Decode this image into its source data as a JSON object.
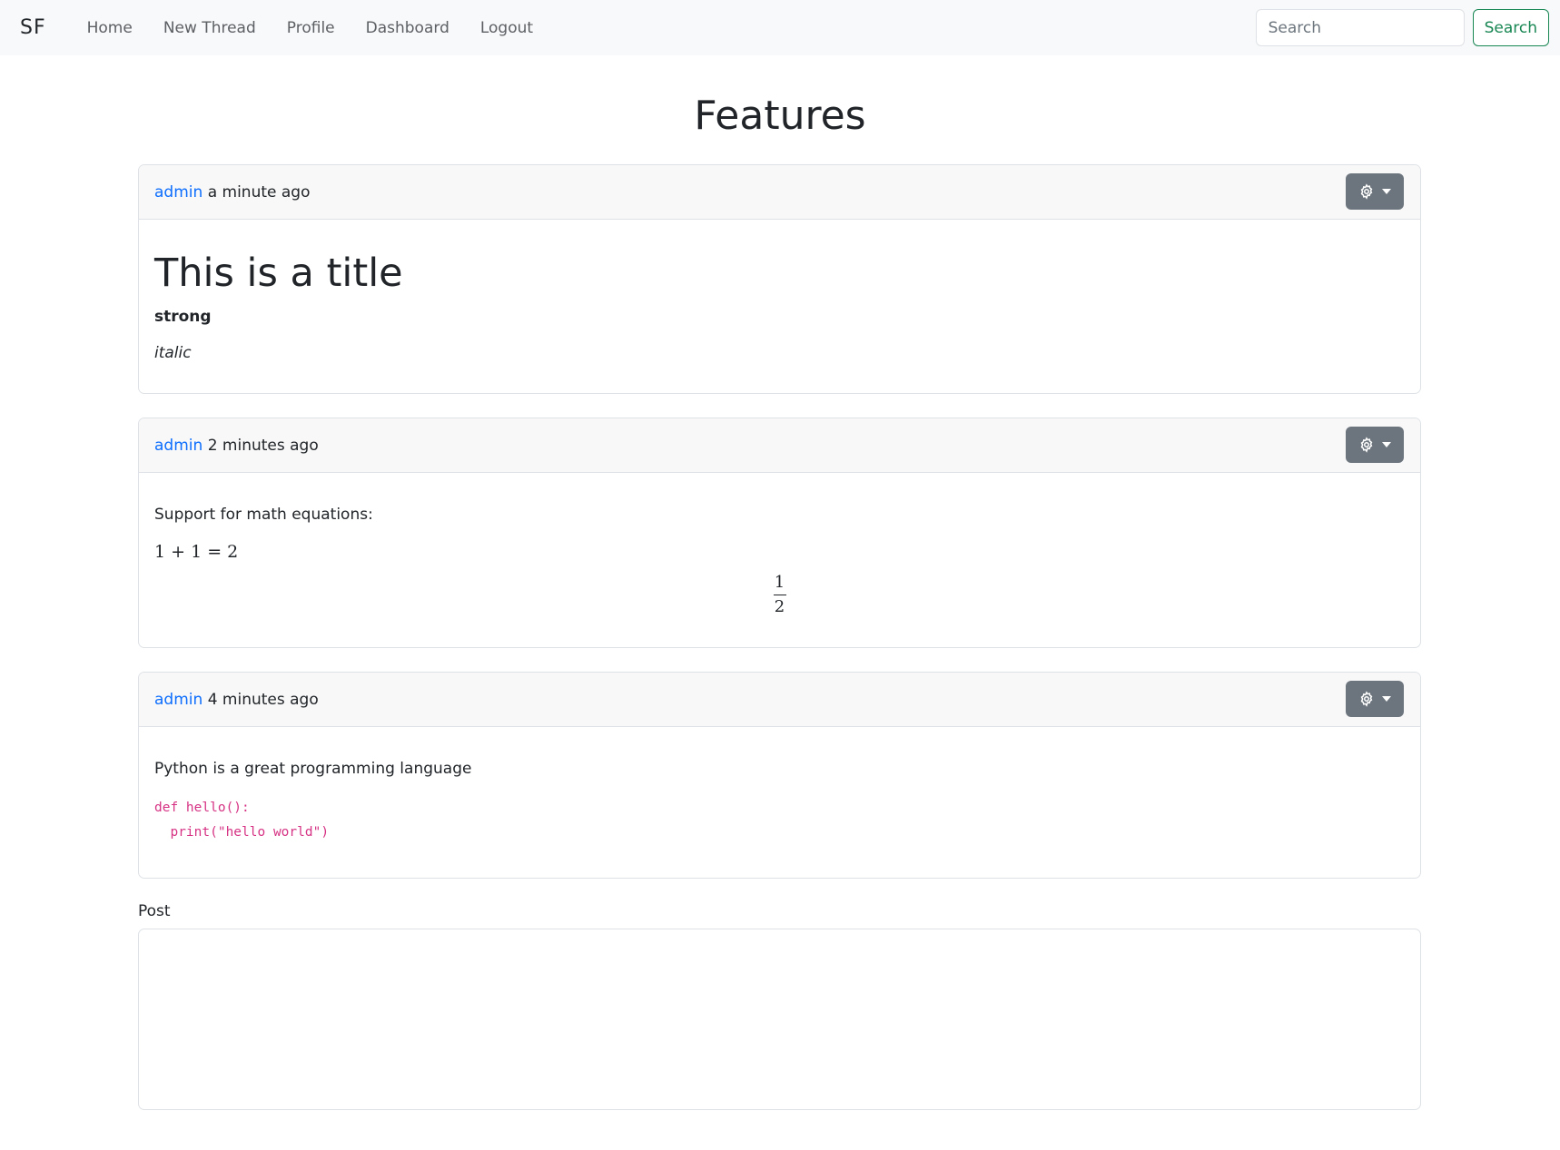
{
  "navbar": {
    "brand": "SF",
    "links": [
      "Home",
      "New Thread",
      "Profile",
      "Dashboard",
      "Logout"
    ],
    "search_placeholder": "Search",
    "search_button": "Search"
  },
  "page": {
    "title": "Features"
  },
  "posts": [
    {
      "author": "admin",
      "time": "a minute ago",
      "heading": "This is a title",
      "strong": "strong",
      "italic": "italic"
    },
    {
      "author": "admin",
      "time": "2 minutes ago",
      "text": "Support for math equations:",
      "math_inline": "1 + 1 = 2",
      "frac_num": "1",
      "frac_den": "2"
    },
    {
      "author": "admin",
      "time": "4 minutes ago",
      "text": "Python is a great programming language",
      "code": "def hello():\n  print(\"hello world\")"
    }
  ],
  "reply": {
    "label": "Post"
  },
  "colors": {
    "link": "#0d6efd",
    "success": "#198754",
    "secondary": "#6c757d",
    "code": "#d63384"
  },
  "icons": {
    "options": "gear-icon",
    "dropdown": "caret-down-icon"
  }
}
